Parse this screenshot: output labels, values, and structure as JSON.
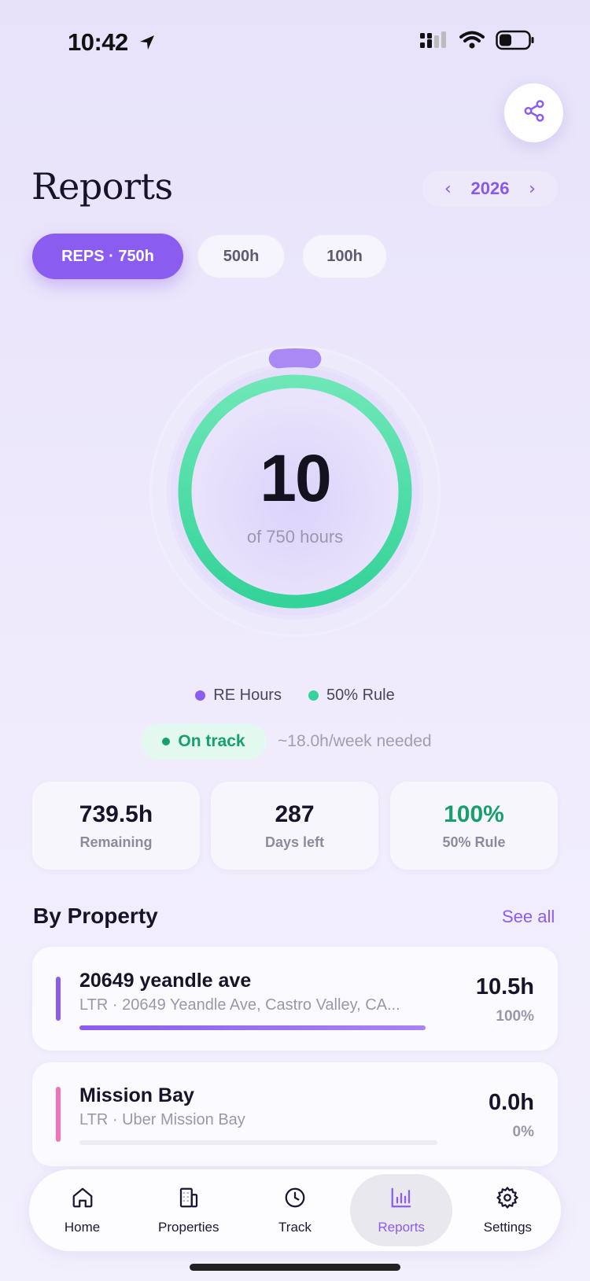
{
  "status_bar": {
    "time": "10:42"
  },
  "header": {
    "title": "Reports",
    "year": "2026"
  },
  "filters": [
    {
      "label": "REPS · 750h",
      "active": true
    },
    {
      "label": "500h",
      "active": false
    },
    {
      "label": "100h",
      "active": false
    }
  ],
  "progress": {
    "value": "10",
    "caption": "of 750 hours",
    "re_fraction": 0.0133,
    "rule_fraction": 1.0
  },
  "legend": [
    {
      "label": "RE Hours",
      "color": "#8b5cf0"
    },
    {
      "label": "50% Rule",
      "color": "#34d399"
    }
  ],
  "status": {
    "badge": "On track",
    "note": "~18.0h/week needed"
  },
  "stats": [
    {
      "value": "739.5h",
      "label": "Remaining",
      "color": "#17142a"
    },
    {
      "value": "287",
      "label": "Days left",
      "color": "#17142a"
    },
    {
      "value": "100%",
      "label": "50% Rule",
      "color": "#16a06b"
    }
  ],
  "by_property": {
    "title": "By Property",
    "see_all": "See all",
    "items": [
      {
        "name": "20649 yeandle ave",
        "subtitle": "LTR · 20649 Yeandle Ave, Castro Valley, CA...",
        "hours": "10.5h",
        "percent": "100%",
        "fraction": 1.0,
        "color": "#8b5cf0"
      },
      {
        "name": "Mission Bay",
        "subtitle": "LTR · Uber Mission Bay",
        "hours": "0.0h",
        "percent": "0%",
        "fraction": 0.0,
        "color": "#f472b6"
      }
    ]
  },
  "tabs": [
    {
      "label": "Home",
      "icon": "home-icon",
      "active": false
    },
    {
      "label": "Properties",
      "icon": "building-icon",
      "active": false
    },
    {
      "label": "Track",
      "icon": "clock-icon",
      "active": false
    },
    {
      "label": "Reports",
      "icon": "chart-icon",
      "active": true
    },
    {
      "label": "Settings",
      "icon": "gear-icon",
      "active": false
    }
  ]
}
